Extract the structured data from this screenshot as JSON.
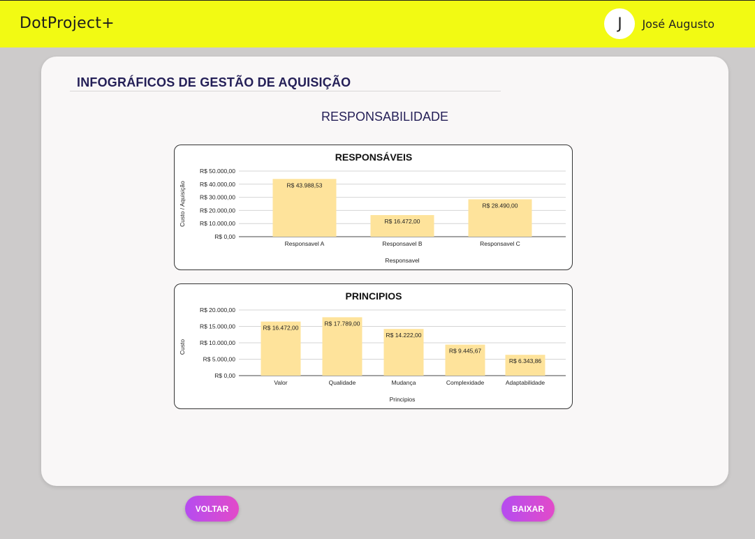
{
  "header": {
    "brand": "DotProject+",
    "avatar_initial": "J",
    "user_name": "José Augusto"
  },
  "page": {
    "title": "INFOGRÁFICOS  DE GESTÃO DE AQUISIÇÃO",
    "section": "RESPONSABILIDADE"
  },
  "buttons": {
    "back": "VOLTAR",
    "download": "BAIXAR"
  },
  "colors": {
    "topbar": "#f2fa13",
    "bar_fill": "#fee39b",
    "title_color": "#241f57",
    "button_gradient": [
      "#b54cf0",
      "#e24bc9"
    ]
  },
  "chart_data": [
    {
      "type": "bar",
      "title": "RESPONSÁVEIS",
      "xlabel": "Responsavel",
      "ylabel": "Custo / Aquisição",
      "categories": [
        "Responsavel A",
        "Responsavel B",
        "Responsavel C"
      ],
      "values": [
        43988.53,
        16472.0,
        28490.0
      ],
      "value_labels": [
        "R$ 43.988,53",
        "R$ 16.472,00",
        "R$ 28.490,00"
      ],
      "ylim": [
        0,
        50000
      ],
      "yticks": [
        0,
        10000,
        20000,
        30000,
        40000,
        50000
      ],
      "ytick_labels": [
        "R$ 0,00",
        "R$ 10.000,00",
        "R$ 20.000,00",
        "R$ 30.000,00",
        "R$ 40.000,00",
        "R$ 50.000,00"
      ],
      "grid": true
    },
    {
      "type": "bar",
      "title": "PRINCIPIOS",
      "xlabel": "Principios",
      "ylabel": "Custo",
      "categories": [
        "Valor",
        "Qualidade",
        "Mudança",
        "Complexidade",
        "Adaptabilidade"
      ],
      "values": [
        16472.0,
        17789.0,
        14222.0,
        9445.67,
        6343.86
      ],
      "value_labels": [
        "R$ 16.472,00",
        "R$ 17.789,00",
        "R$ 14.222,00",
        "R$ 9.445,67",
        "R$ 6.343,86"
      ],
      "ylim": [
        0,
        20000
      ],
      "yticks": [
        0,
        5000,
        10000,
        15000,
        20000
      ],
      "ytick_labels": [
        "R$ 0,00",
        "R$ 5.000,00",
        "R$ 10.000,00",
        "R$ 15.000,00",
        "R$ 20.000,00"
      ],
      "grid": true
    }
  ]
}
